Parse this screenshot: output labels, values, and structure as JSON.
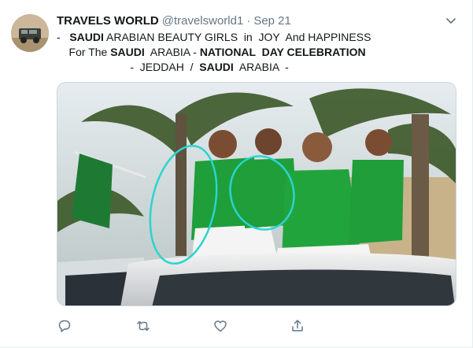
{
  "author": {
    "name": "TRAVELS WORLD",
    "handle": "@travelsworld1",
    "separator": "·",
    "date": "Sep 21"
  },
  "tweet_lines": [
    [
      {
        "t": "-   ",
        "b": false
      },
      {
        "t": "SAUDI",
        "b": true
      },
      {
        "t": " ARABIAN BEAUTY GIRLS  in  JOY  And HAPPINESS",
        "b": false
      }
    ],
    [
      {
        "t": "    For The ",
        "b": false
      },
      {
        "t": "SAUDI",
        "b": true
      },
      {
        "t": "  ARABIA - ",
        "b": false
      },
      {
        "t": "NATIONAL  DAY CELEBRATION",
        "b": true
      }
    ],
    [
      {
        "t": "                        -  JEDDAH  /  ",
        "b": false
      },
      {
        "t": "SAUDI",
        "b": true
      },
      {
        "t": "  ARABIA  -",
        "b": false
      }
    ]
  ],
  "icons": {
    "menu": "chevron-down-icon",
    "reply": "reply-icon",
    "retweet": "retweet-icon",
    "like": "heart-icon",
    "share": "share-icon"
  },
  "colors": {
    "text": "#14171a",
    "secondary": "#657786",
    "icon": "#657786",
    "annotation": "#2ad4d0",
    "green": "#1f9e3a"
  }
}
